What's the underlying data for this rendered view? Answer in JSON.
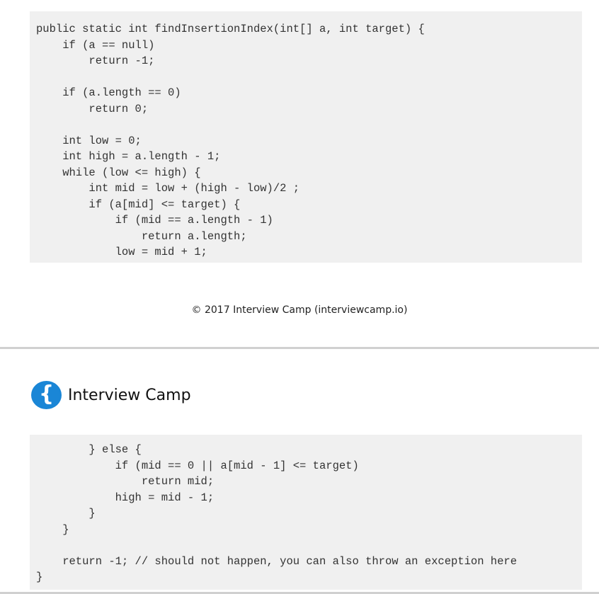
{
  "code_page_1": {
    "lines": [
      "public static int findInsertionIndex(int[] a, int target) {",
      "    if (a == null)",
      "        return -1;",
      "",
      "    if (a.length == 0)",
      "        return 0;",
      "",
      "    int low = 0;",
      "    int high = a.length - 1;",
      "    while (low <= high) {",
      "        int mid = low + (high - low)/2 ;",
      "        if (a[mid] <= target) {",
      "            if (mid == a.length - 1)",
      "                return a.length;",
      "            low = mid + 1;"
    ]
  },
  "footer": {
    "copyright": "© 2017 Interview Camp (interviewcamp.io)"
  },
  "header": {
    "logo_glyph": "{",
    "brand_name": "Interview Camp"
  },
  "code_page_2": {
    "lines": [
      "        } else {",
      "            if (mid == 0 || a[mid - 1] <= target)",
      "                return mid;",
      "            high = mid - 1;",
      "        }",
      "    }",
      "",
      "    return -1; // should not happen, you can also throw an exception here",
      "}"
    ]
  },
  "colors": {
    "logo_bg": "#1a86d6",
    "code_bg": "#f0f0f0",
    "divider": "#d0d0d0"
  }
}
